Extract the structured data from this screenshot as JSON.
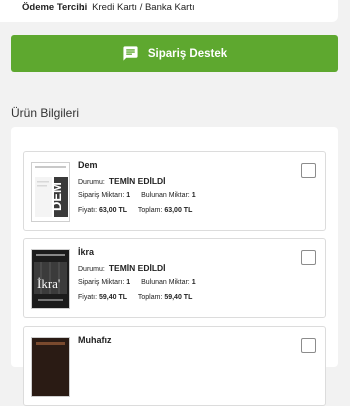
{
  "payment": {
    "label": "Ödeme Tercihi",
    "colon": ":",
    "value": "Kredi Kartı / Banka Kartı"
  },
  "support": {
    "label": "Sipariş Destek",
    "icon": "chat-icon"
  },
  "section_title": "Ürün Bilgileri",
  "labels": {
    "status": "Durumu:",
    "ordered": "Sipariş Miktarı:",
    "found": "Bulunan Miktar:",
    "price": "Fiyatı:",
    "total": "Toplam:"
  },
  "products": [
    {
      "name": "Dem",
      "status": "TEMİN EDİLDİ",
      "ordered": "1",
      "found": "1",
      "price": "63,00 TL",
      "total": "63,00 TL",
      "cover_text": "DEM"
    },
    {
      "name": "İkra",
      "status": "TEMİN EDİLDİ",
      "ordered": "1",
      "found": "1",
      "price": "59,40 TL",
      "total": "59,40 TL",
      "cover_text": "İkra"
    },
    {
      "name": "Muhafız"
    }
  ],
  "colors": {
    "accent": "#5ea82f",
    "background": "#f2f2f2"
  }
}
